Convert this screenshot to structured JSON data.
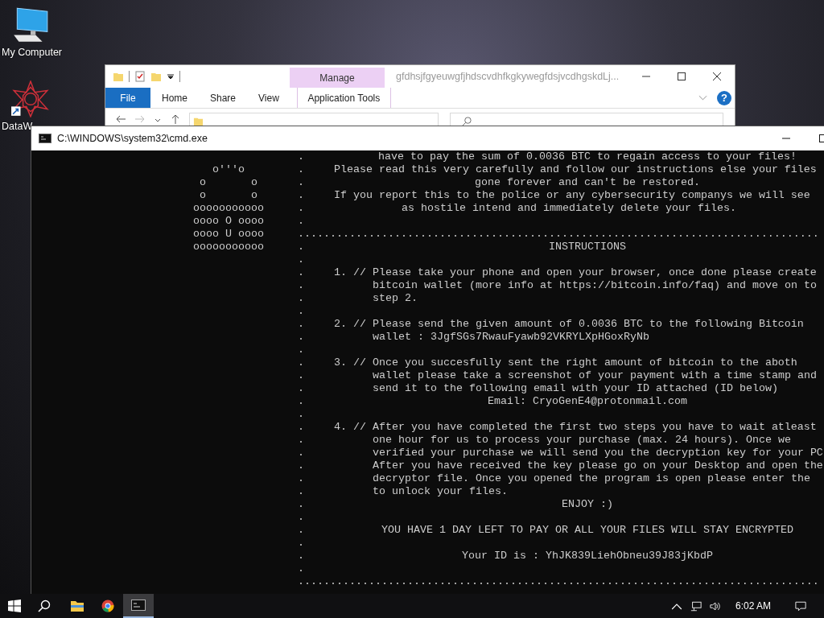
{
  "desktop": {
    "icons": [
      {
        "label": "My Computer",
        "kind": "computer"
      },
      {
        "label": "DataW",
        "kind": "shortcut"
      }
    ]
  },
  "explorer": {
    "context_tab": "Manage",
    "title": "gfdhsjfgyeuwgfjhdscvdhfkgkywegfdsjvcdhgskdLj...",
    "help": "?",
    "ribbon_tabs": [
      {
        "label": "File",
        "kind": "file"
      },
      {
        "label": "Home",
        "kind": "tab"
      },
      {
        "label": "Share",
        "kind": "tab"
      },
      {
        "label": "View",
        "kind": "tab"
      },
      {
        "label": "Application Tools",
        "kind": "context"
      }
    ]
  },
  "console": {
    "title": "C:\\WINDOWS\\system32\\cmd.exe",
    "lines": [
      {
        "kind": "center",
        "gutter": ".",
        "text": "have to pay the sum of 0.0036 BTC to regain access to your files!"
      },
      {
        "kind": "item",
        "art": "o'''o",
        "gutter": ".",
        "text": "Please read this very carefully and follow our instructions else your files"
      },
      {
        "kind": "center",
        "art": "o       o",
        "gutter": ".",
        "text": "gone forever and can't be restored."
      },
      {
        "kind": "item",
        "art": "o       o",
        "gutter": ".",
        "text": "If you report this to the police or any cybersecurity companys we will see"
      },
      {
        "kind": "hostile",
        "art": "ooooooooooo",
        "gutter": ".",
        "text": "as hostile intend and immediately delete your files."
      },
      {
        "kind": "blank",
        "art": "oooo O oooo",
        "gutter": "."
      },
      {
        "kind": "rule",
        "art": "oooo U oooo",
        "text": "................................................................................."
      },
      {
        "kind": "center",
        "art": "ooooooooooo",
        "gutter": ".",
        "text": "INSTRUCTIONS"
      },
      {
        "kind": "blank",
        "gutter": "."
      },
      {
        "kind": "item",
        "gutter": ".",
        "text": "1. // Please take your phone and open your browser, once done please create"
      },
      {
        "kind": "cont",
        "gutter": ".",
        "text": "bitcoin wallet (more info at https://bitcoin.info/faq) and move on to"
      },
      {
        "kind": "cont",
        "gutter": ".",
        "text": "step 2."
      },
      {
        "kind": "blank",
        "gutter": "."
      },
      {
        "kind": "item",
        "gutter": ".",
        "text": "2. // Please send the given amount of 0.0036 BTC to the following Bitcoin"
      },
      {
        "kind": "cont",
        "gutter": ".",
        "text": "wallet : 3JgfSGs7RwauFyawb92VKRYLXpHGoxRyNb"
      },
      {
        "kind": "blank",
        "gutter": "."
      },
      {
        "kind": "item",
        "gutter": ".",
        "text": "3. // Once you succesfully sent the right amount of bitcoin to the aboth"
      },
      {
        "kind": "cont",
        "gutter": ".",
        "text": "wallet please take a screenshot of your payment with a time stamp and"
      },
      {
        "kind": "cont",
        "gutter": ".",
        "text": "send it to the following email with your ID attached (ID below)"
      },
      {
        "kind": "center",
        "gutter": ".",
        "text": "Email: CryoGenE4@protonmail.com"
      },
      {
        "kind": "blank",
        "gutter": "."
      },
      {
        "kind": "item",
        "gutter": ".",
        "text": "4. // After you have completed the first two steps you have to wait atleast"
      },
      {
        "kind": "cont",
        "gutter": ".",
        "text": "one hour for us to process your purchase (max. 24 hours). Once we"
      },
      {
        "kind": "cont",
        "gutter": ".",
        "text": "verified your purchase we will send you the decryption key for your PC"
      },
      {
        "kind": "cont",
        "gutter": ".",
        "text": "After you have received the key please go on your Desktop and open the"
      },
      {
        "kind": "cont",
        "gutter": ".",
        "text": "decryptor file. Once you opened the program is open please enter the"
      },
      {
        "kind": "cont",
        "gutter": ".",
        "text": "to unlock your files."
      },
      {
        "kind": "center",
        "gutter": ".",
        "text": "ENJOY :)"
      },
      {
        "kind": "blank",
        "gutter": "."
      },
      {
        "kind": "center",
        "gutter": ".",
        "text": "YOU HAVE 1 DAY LEFT TO PAY OR ALL YOUR FILES WILL STAY ENCRYPTED"
      },
      {
        "kind": "blank",
        "gutter": "."
      },
      {
        "kind": "center",
        "gutter": ".",
        "text": "Your ID is : YhJK839LiehObneu39J83jKbdP"
      },
      {
        "kind": "blank",
        "gutter": "."
      },
      {
        "kind": "rule",
        "text": "................................................................................."
      }
    ]
  },
  "taskbar": {
    "clock": "6:02 AM",
    "apps": [
      {
        "kind": "explorer",
        "active": false
      },
      {
        "kind": "chrome",
        "active": false
      },
      {
        "kind": "cmd",
        "active": true
      }
    ]
  }
}
